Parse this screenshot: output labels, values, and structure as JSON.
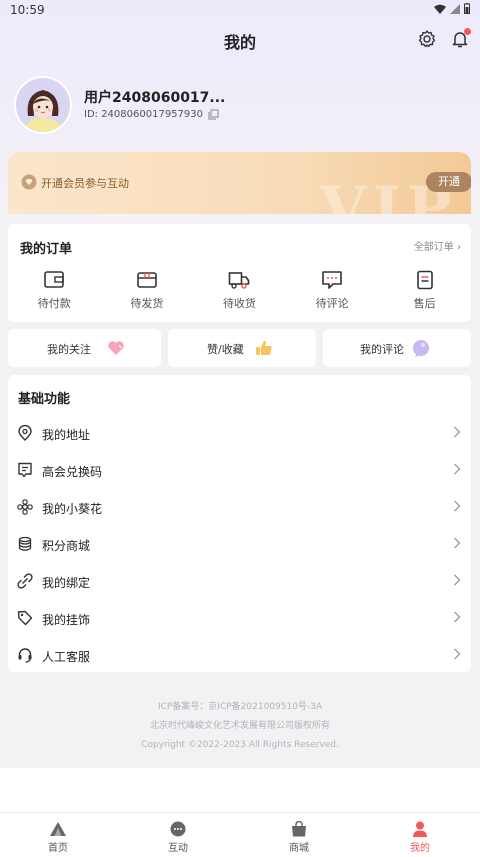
{
  "status_bar": {
    "time": "10:59"
  },
  "header": {
    "title": "我的"
  },
  "profile": {
    "name": "用户2408060017...",
    "id_label": "ID: 2408060017957930"
  },
  "vip": {
    "text": "开通会员参与互动",
    "button": "开通",
    "watermark": "VIP"
  },
  "orders": {
    "title": "我的订单",
    "all_link": "全部订单",
    "items": [
      {
        "label": "待付款",
        "icon": "wallet-icon"
      },
      {
        "label": "待发货",
        "icon": "package-icon"
      },
      {
        "label": "待收货",
        "icon": "truck-icon"
      },
      {
        "label": "待评论",
        "icon": "comment-icon"
      },
      {
        "label": "售后",
        "icon": "aftersale-icon"
      }
    ]
  },
  "quick": [
    {
      "label": "我的关注",
      "icon": "heart-icon"
    },
    {
      "label": "赞/收藏",
      "icon": "thumbs-up-icon"
    },
    {
      "label": "我的评论",
      "icon": "chat-bubble-icon"
    }
  ],
  "basic": {
    "title": "基础功能",
    "items": [
      {
        "label": "我的地址",
        "icon": "location-icon"
      },
      {
        "label": "高会兑换码",
        "icon": "ticket-icon"
      },
      {
        "label": "我的小葵花",
        "icon": "flower-icon"
      },
      {
        "label": "积分商城",
        "icon": "coins-icon"
      },
      {
        "label": "我的绑定",
        "icon": "link-icon"
      },
      {
        "label": "我的挂饰",
        "icon": "tag-icon"
      },
      {
        "label": "人工客服",
        "icon": "headset-icon"
      }
    ]
  },
  "footer": {
    "icp": "ICP备案号：京ICP备2021009510号-3A",
    "company": "北京时代峰峻文化艺术发展有限公司版权所有",
    "copyright": "Copyright ©2022-2023 All Rights Reserved."
  },
  "tabbar": [
    {
      "label": "首页",
      "icon": "home-icon"
    },
    {
      "label": "互动",
      "icon": "interact-icon"
    },
    {
      "label": "商城",
      "icon": "shop-bag-icon"
    },
    {
      "label": "我的",
      "icon": "profile-icon",
      "active": true
    }
  ],
  "colors": {
    "accent": "#f25a5a",
    "vip_button": "#ad8461",
    "vip_text": "#8a5a2a"
  }
}
